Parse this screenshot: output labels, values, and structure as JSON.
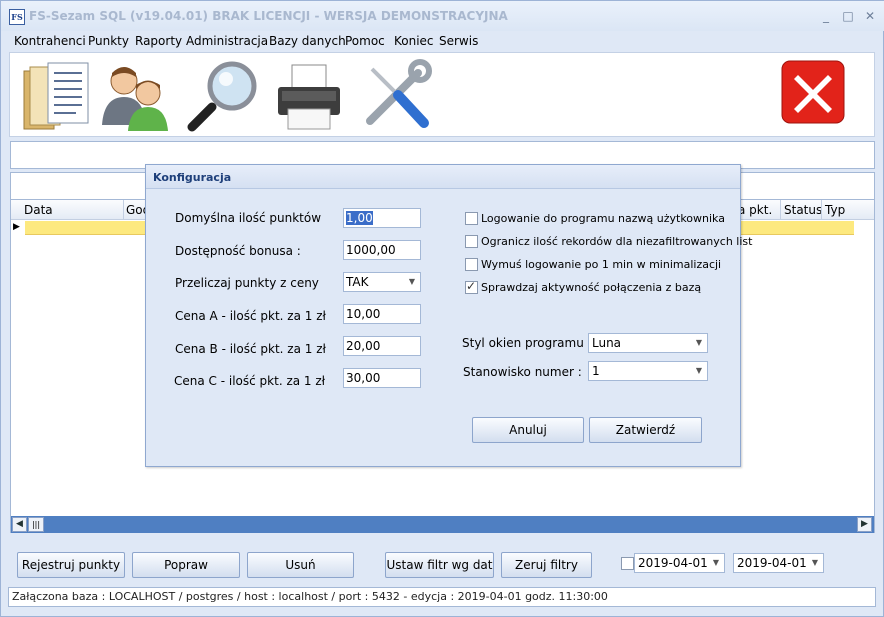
{
  "window": {
    "app_icon": "FS",
    "title": "FS-Sezam SQL  (v19.04.01)    BRAK LICENCJI - WERSJA DEMONSTRACYJNA",
    "minimize_icon": "_",
    "maximize_icon": "□",
    "close_icon": "✕"
  },
  "menu": [
    "Kontrahenci",
    "Punkty",
    "Raporty",
    "Administracja",
    "Bazy danych",
    "Pomoc",
    "Koniec",
    "Serwis"
  ],
  "toolbar": {
    "icons": [
      "documents-icon",
      "users-icon",
      "magnifier-icon",
      "printer-icon",
      "tools-icon",
      "close-app-icon"
    ]
  },
  "grid": {
    "columns": [
      "Data",
      "God",
      "a pkt.",
      "Status",
      "Typ"
    ],
    "row_indicator": "▶"
  },
  "scrollbar": {
    "left_arrow": "◀",
    "right_arrow": "▶",
    "thumb": "|||"
  },
  "buttons": {
    "register_points": "Rejestruj punkty",
    "edit": "Popraw",
    "delete": "Usuń",
    "date_filter": "Ustaw filtr wg dat",
    "reset_filters": "Zeruj filtry"
  },
  "date_filter": {
    "from": "2019-04-01",
    "to": "2019-04-01",
    "enabled": false
  },
  "status_bar": "Załączona baza : LOCALHOST  / postgres / host : localhost  / port : 5432  -   edycja : 2019-04-01  godz. 11:30:00",
  "dialog": {
    "title": "Konfiguracja",
    "fields": [
      {
        "label": "Domyślna ilość punktów",
        "value": "1,00",
        "selected": true
      },
      {
        "label": "Dostępność bonusa :",
        "value": "1000,00"
      },
      {
        "label": "Przeliczaj punkty z ceny",
        "value": "TAK",
        "dropdown": true
      },
      {
        "label": "Cena A - ilość pkt. za 1 zł",
        "value": "10,00"
      },
      {
        "label": "Cena B - ilość pkt. za 1 zł",
        "value": "20,00"
      },
      {
        "label": "Cena C - ilość pkt. za 1 zł",
        "value": "30,00"
      }
    ],
    "checkboxes": [
      {
        "label": "Logowanie do programu nazwą użytkownika",
        "checked": false
      },
      {
        "label": "Ogranicz ilość rekordów dla niezafiltrowanych list",
        "checked": false
      },
      {
        "label": "Wymuś logowanie po 1 min w minimalizacji",
        "checked": false
      },
      {
        "label": "Sprawdzaj aktywność połączenia z bazą",
        "checked": true
      }
    ],
    "window_style": {
      "label": "Styl okien programu :",
      "value": "Luna"
    },
    "station": {
      "label": "Stanowisko numer :",
      "value": "1"
    },
    "cancel": "Anuluj",
    "confirm": "Zatwierdź"
  }
}
